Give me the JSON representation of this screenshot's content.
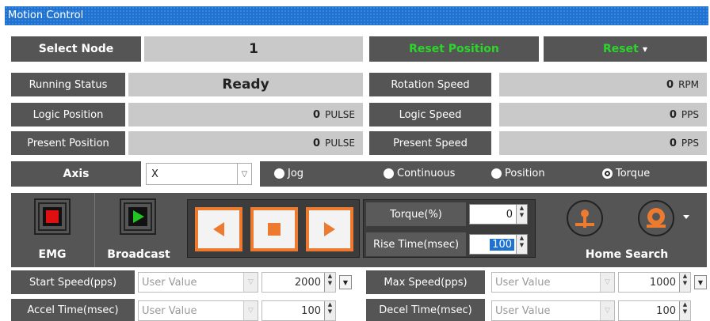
{
  "window": {
    "title": "Motion Control"
  },
  "row1": {
    "select_node_label": "Select Node",
    "node_value": "1",
    "reset_position_label": "Reset Position",
    "reset_label": "Reset"
  },
  "status": {
    "running_status_label": "Running Status",
    "running_status_value": "Ready",
    "rotation_speed_label": "Rotation Speed",
    "rotation_speed_value": "0",
    "rotation_speed_unit": "RPM",
    "logic_position_label": "Logic Position",
    "logic_position_value": "0",
    "logic_position_unit": "PULSE",
    "logic_speed_label": "Logic Speed",
    "logic_speed_value": "0",
    "logic_speed_unit": "PPS",
    "present_position_label": "Present Position",
    "present_position_value": "0",
    "present_position_unit": "PULSE",
    "present_speed_label": "Present Speed",
    "present_speed_value": "0",
    "present_speed_unit": "PPS"
  },
  "axis": {
    "label": "Axis",
    "value": "X",
    "modes": [
      "Jog",
      "Continuous",
      "Position",
      "Torque"
    ],
    "selected_mode": "Torque"
  },
  "controls": {
    "emg_label": "EMG",
    "broadcast_label": "Broadcast",
    "torque_label": "Torque(%)",
    "torque_value": "0",
    "rise_time_label": "Rise Time(msec)",
    "rise_time_value": "100",
    "home_search_label": "Home Search"
  },
  "params": {
    "start_speed_label": "Start Speed(pps)",
    "start_speed_mode": "User Value",
    "start_speed_value": "2000",
    "max_speed_label": "Max Speed(pps)",
    "max_speed_mode": "User Value",
    "max_speed_value": "1000",
    "accel_time_label": "Accel Time(msec)",
    "accel_time_mode": "User Value",
    "accel_time_value": "100",
    "decel_time_label": "Decel Time(msec)",
    "decel_time_mode": "User Value",
    "decel_time_value": "100"
  },
  "colors": {
    "title_bar": "#1e73d2",
    "dark_panel": "#555555",
    "value_panel": "#c9c9c9",
    "green_text": "#2bd52b",
    "accent_orange": "#ec7a2f",
    "emg_red": "#e01010",
    "broadcast_green": "#22c422"
  }
}
